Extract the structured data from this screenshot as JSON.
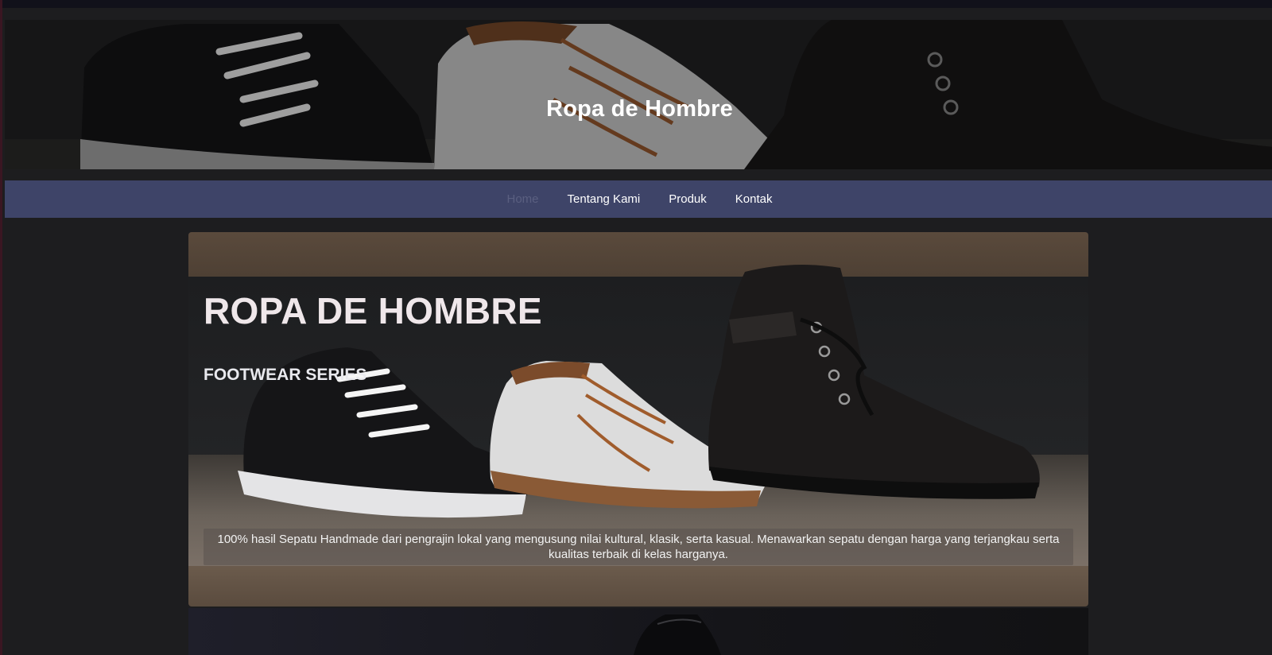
{
  "banner": {
    "title": "Ropa de Hombre"
  },
  "nav": {
    "items": [
      {
        "label": "Home",
        "active": true
      },
      {
        "label": "Tentang Kami",
        "active": false
      },
      {
        "label": "Produk",
        "active": false
      },
      {
        "label": "Kontak",
        "active": false
      }
    ]
  },
  "hero": {
    "heading": "ROPA DE HOMBRE",
    "subheading": "FOOTWEAR SERIES",
    "caption": "100% hasil Sepatu Handmade dari pengrajin lokal yang mengusung nilai kultural, klasik, serta kasual. Menawarkan sepatu dengan harga yang terjangkau serta kualitas terbaik di kelas harganya."
  },
  "colors": {
    "background": "#1d1d1f",
    "navbar": "#3e4468",
    "nav_active": "#5a5f80",
    "text_light": "#ffffff"
  }
}
